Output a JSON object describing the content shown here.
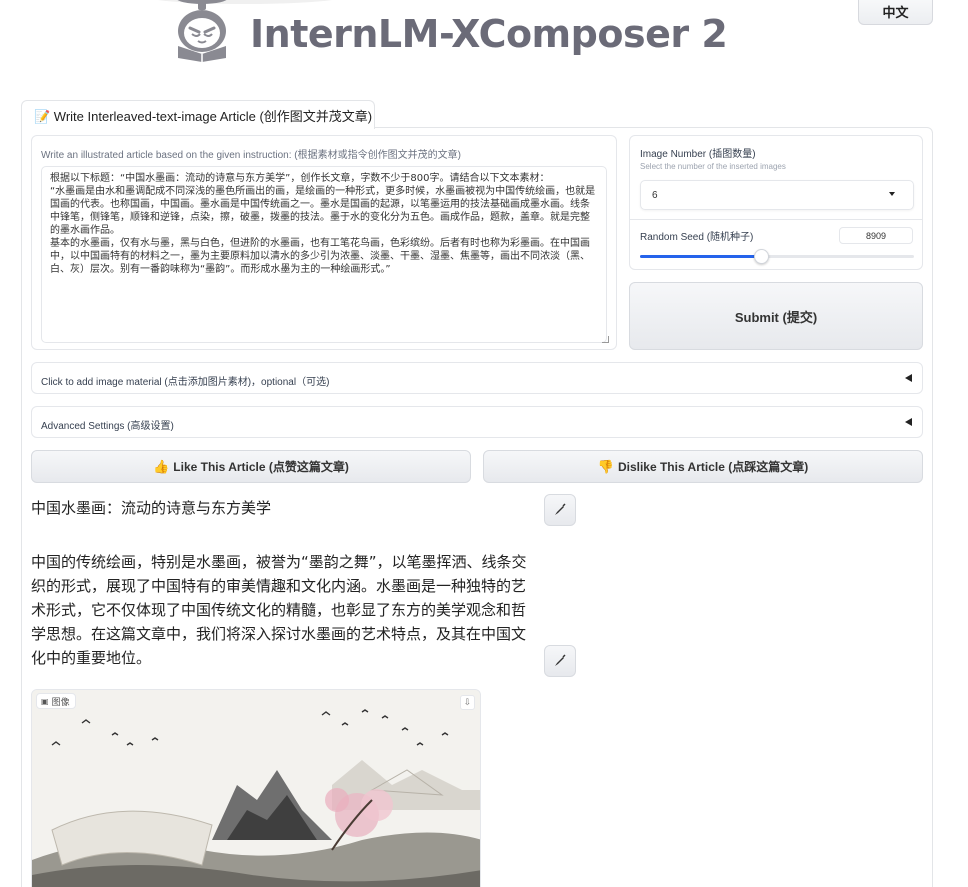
{
  "app": {
    "title": "InternLM-XComposer 2",
    "lang_button": "中文"
  },
  "tab": {
    "label": "📝 Write Interleaved-text-image Article (创作图文并茂文章)"
  },
  "instruction": {
    "label": "Write an illustrated article based on the given instruction: (根据素材或指令创作图文并茂的文章)",
    "value": "根据以下标题：“中国水墨画：流动的诗意与东方美学”，创作长文章，字数不少于800字。请结合以下文本素材：\n“水墨画是由水和墨调配成不同深浅的墨色所画出的画，是绘画的一种形式，更多时候，水墨画被视为中国传统绘画，也就是国画的代表。也称国画，中国画。墨水画是中国传统画之一。墨水是国画的起源，以笔墨运用的技法基础画成墨水画。线条中锋笔，侧锋笔，顺锋和逆锋，点染，擦，破墨，拨墨的技法。墨于水的变化分为五色。画成作品，题款，盖章。就是完整的墨水画作品。\n基本的水墨画，仅有水与墨，黑与白色，但进阶的水墨画，也有工笔花鸟画，色彩缤纷。后者有时也称为彩墨画。在中国画中，以中国画特有的材料之一，墨为主要原料加以清水的多少引为浓墨、淡墨、干墨、湿墨、焦墨等，画出不同浓淡（黑、白、灰）层次。别有一番韵味称为“墨韵”。而形成水墨为主的一种绘画形式。”"
  },
  "image_number": {
    "label": "Image Number (插图数量)",
    "info": "Select the number of the inserted images",
    "value": "6"
  },
  "seed": {
    "label": "Random Seed (随机种子)",
    "value": "8909",
    "slider_fraction": 0.44
  },
  "submit": {
    "label": "Submit (提交)"
  },
  "accordions": {
    "image_material": "Click to add image material (点击添加图片素材)，optional（可选)",
    "advanced": "Advanced Settings (高级设置)"
  },
  "vote": {
    "like_emoji": "👍",
    "like": "Like This Article (点赞这篇文章)",
    "dislike_emoji": "👎",
    "dislike": "Dislike This Article (点踩这篇文章)"
  },
  "article": {
    "title": "中国水墨画：流动的诗意与东方美学",
    "paragraph": "中国的传统绘画，特别是水墨画，被誉为“墨韵之舞”，以笔墨挥洒、线条交织的形式，展现了中国特有的审美情趣和文化内涵。水墨画是一种独特的艺术形式，它不仅体现了中国传统文化的精髓，也彰显了东方的美学观念和哲学思想。在这篇文章中，我们将深入探讨水墨画的艺术特点，及其在中国文化中的重要地位。",
    "image_badge": "图像"
  }
}
